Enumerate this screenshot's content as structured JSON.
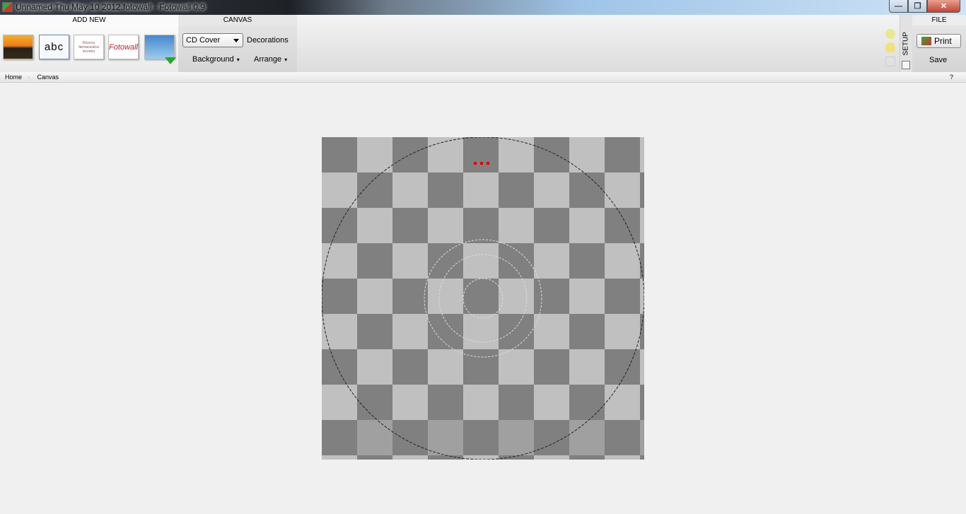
{
  "window": {
    "title": "Unnamed Thu May 10 2012.fotowall - Fotowall 0.9",
    "minimize": "—",
    "maximize": "❐",
    "close": "✕"
  },
  "ribbon": {
    "add_new": {
      "header": "ADD NEW",
      "text_tool": "abc",
      "wordcloud_tool": "Ricerca farmaceutica incontro",
      "fotowall_tool": "Fotowall"
    },
    "canvas": {
      "header": "CANVAS",
      "mode_select": "CD Cover",
      "decorations": "Decorations",
      "background": "Background",
      "arrange": "Arrange"
    },
    "setup": {
      "label": "SETUP"
    },
    "file": {
      "header": "FILE",
      "print": "Print",
      "save": "Save"
    }
  },
  "breadcrumb": {
    "items": [
      "Home",
      "Canvas"
    ],
    "help": "?"
  },
  "colors": {
    "dark_square": "#808080",
    "light_square": "#c0c0c0",
    "handle_dots": "#e00000"
  }
}
